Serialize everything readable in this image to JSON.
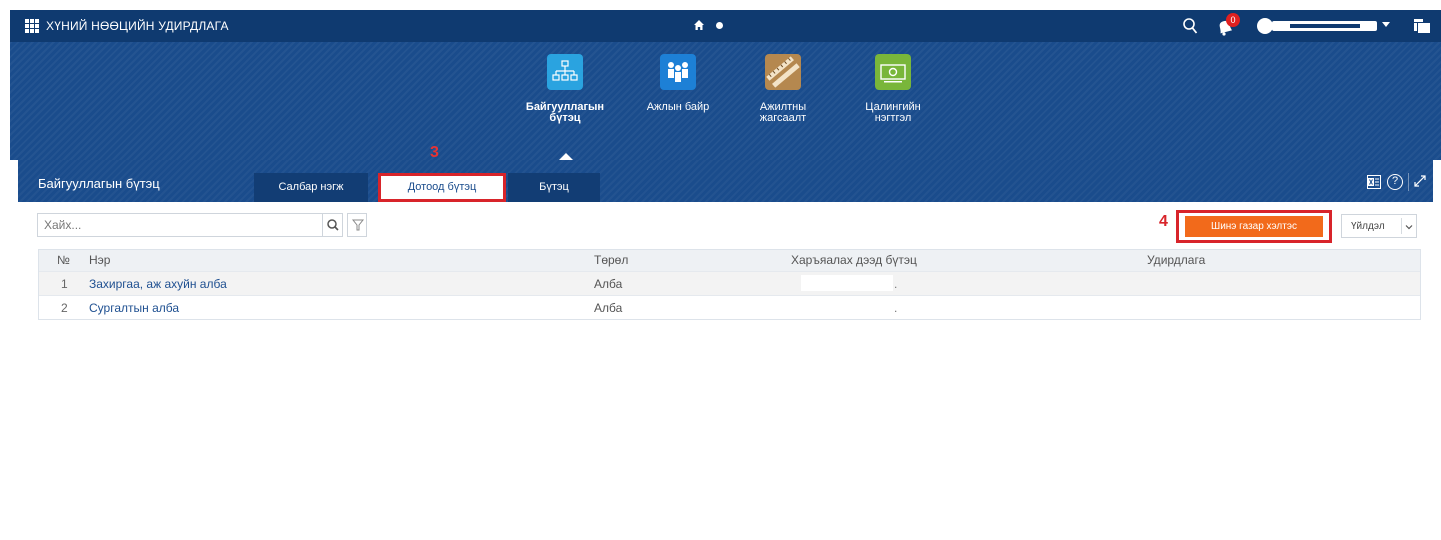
{
  "header": {
    "app_title": "ХҮНИЙ НӨӨЦИЙН УДИРДЛАГА",
    "notifications_count": "0",
    "colors": {
      "bar": "#0f3a70",
      "hero": "#1a4c8c",
      "badge": "#e02020"
    }
  },
  "modules": [
    {
      "label": "Байгууллагын бүтэц",
      "icon": "org-structure-icon",
      "color": "#2aa3e0",
      "active": true
    },
    {
      "label": "Ажлын байр",
      "icon": "people-icon",
      "color": "#1d80d6",
      "active": false
    },
    {
      "label": "Ажилтны жагсаалт",
      "icon": "ruler-list-icon",
      "color": "#b5884f",
      "active": false
    },
    {
      "label": "Цалингийн нэгтгэл",
      "icon": "money-icon",
      "color": "#79b63a",
      "active": false
    }
  ],
  "annotations": {
    "step3": "3",
    "step4": "4"
  },
  "panel": {
    "title": "Байгууллагын бүтэц",
    "tabs": [
      {
        "label": "Салбар нэгж",
        "active": false
      },
      {
        "label": "Дотоод бүтэц",
        "active": true
      },
      {
        "label": "Бүтэц",
        "active": false
      }
    ]
  },
  "toolbar": {
    "search_placeholder": "Хайх...",
    "primary_label": "Шинэ газар хэлтэс",
    "primary_color": "#f26a1b",
    "action_label": "Үйлдэл"
  },
  "table": {
    "columns": [
      "№",
      "Нэр",
      "Төрөл",
      "Харъяалах дээд бүтэц",
      "Удирдлага"
    ],
    "rows": [
      {
        "no": "1",
        "name": "Захиргаа, аж ахуйн алба",
        "type": "Алба",
        "parent": ".",
        "management": ""
      },
      {
        "no": "2",
        "name": "Сургалтын алба",
        "type": "Алба",
        "parent": ".",
        "management": ""
      }
    ]
  }
}
